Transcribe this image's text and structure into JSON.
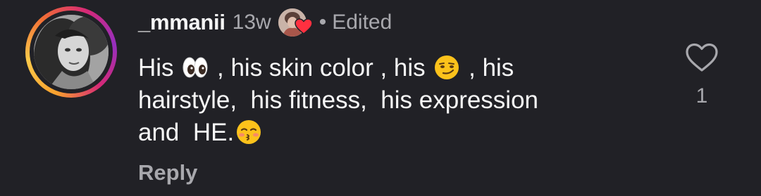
{
  "comment": {
    "username": "_mmanii",
    "timestamp": "13w",
    "separator": "•",
    "edited_label": "Edited",
    "text": {
      "line1_a": "His ",
      "line1_b": " , his skin color , his ",
      "line1_c": " , his",
      "line2": "hairstyle,  his fitness,  his expression",
      "line3_a": "and  HE."
    },
    "emojis": [
      "eyes-emoji",
      "smirking-face-emoji",
      "kissing-face-emoji"
    ],
    "reply_label": "Reply",
    "like_count": "1",
    "liked_by_creator": true
  },
  "colors": {
    "background": "#212126",
    "primary_text": "#f7f7f7",
    "secondary_text": "#a8a8ad",
    "heart_red": "#ff3040",
    "story_ring": [
      "#f9a12e",
      "#d62976",
      "#962fbf"
    ]
  }
}
